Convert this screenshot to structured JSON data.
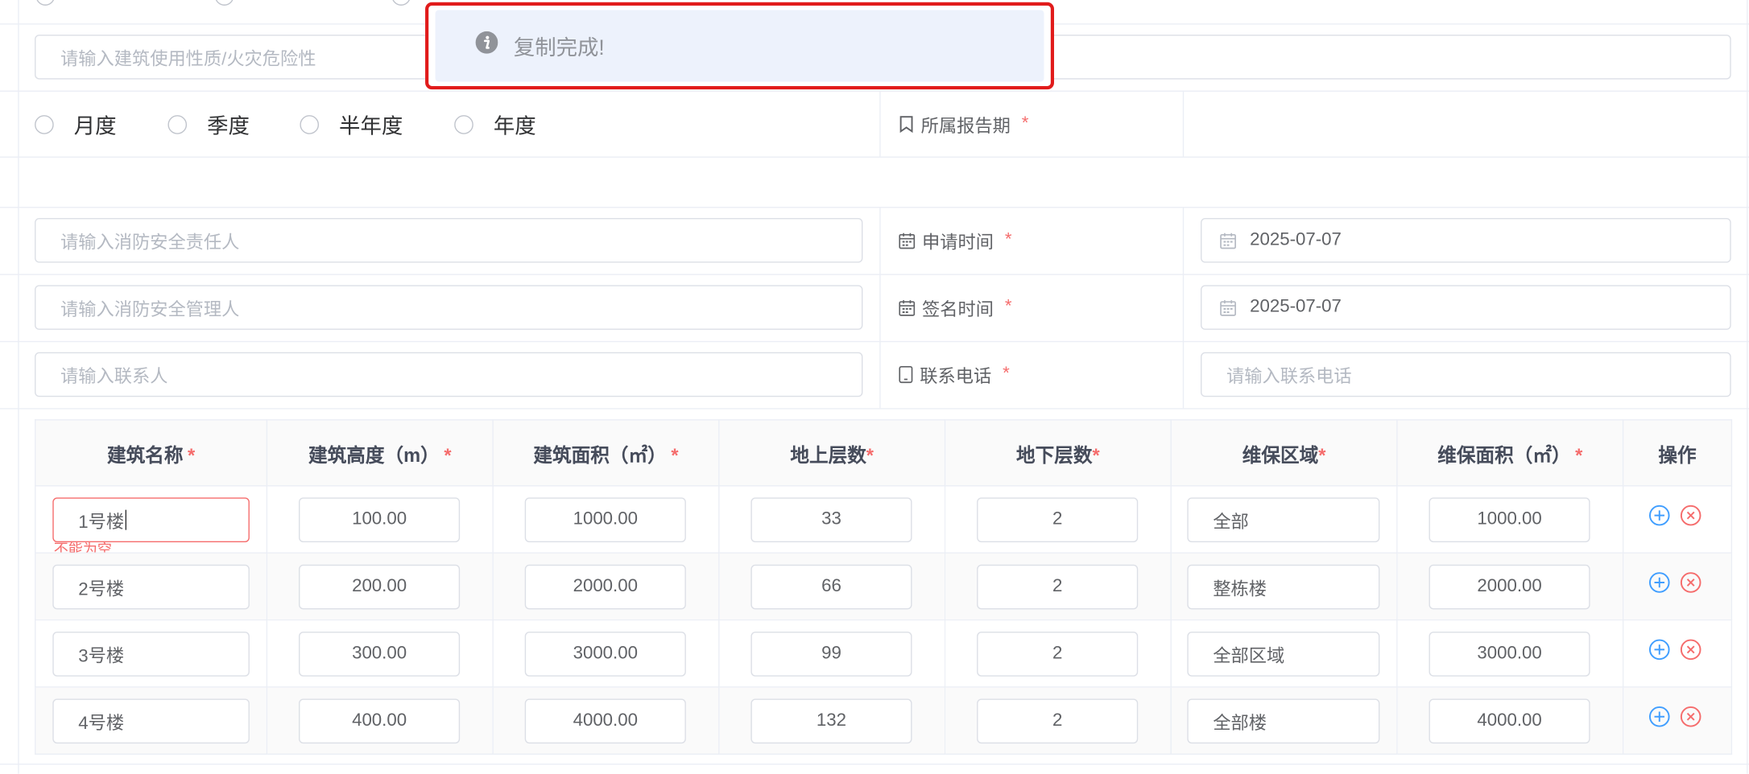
{
  "form": {
    "building_nature_placeholder": "请输入建筑使用性质/火灾危险性",
    "period_options": [
      "月度",
      "季度",
      "半年度",
      "年度"
    ],
    "report_period_label": "所属报告期",
    "safety_responsible_placeholder": "请输入消防安全责任人",
    "apply_time_label": "申请时间",
    "apply_time_value": "2025-07-07",
    "safety_manager_placeholder": "请输入消防安全管理人",
    "sign_time_label": "签名时间",
    "sign_time_value": "2025-07-07",
    "contact_placeholder": "请输入联系人",
    "phone_label": "联系电话",
    "phone_placeholder": "请输入联系电话",
    "required_mark": "*"
  },
  "table": {
    "headers": [
      "建筑名称",
      "建筑高度（m）",
      "建筑面积（㎡）",
      "地上层数",
      "地下层数",
      "维保区域",
      "维保面积（㎡）",
      "操作"
    ],
    "rows": [
      {
        "name": "1号楼",
        "height": "100.00",
        "area": "1000.00",
        "above": "33",
        "below": "2",
        "region": "全部",
        "maint_area": "1000.00"
      },
      {
        "name": "2号楼",
        "height": "200.00",
        "area": "2000.00",
        "above": "66",
        "below": "2",
        "region": "整栋楼",
        "maint_area": "2000.00"
      },
      {
        "name": "3号楼",
        "height": "300.00",
        "area": "3000.00",
        "above": "99",
        "below": "2",
        "region": "全部区域",
        "maint_area": "3000.00"
      },
      {
        "name": "4号楼",
        "height": "400.00",
        "area": "4000.00",
        "above": "132",
        "below": "2",
        "region": "全部楼",
        "maint_area": "4000.00"
      }
    ],
    "error_text": "不能为空"
  },
  "toast": {
    "message": "复制完成!"
  },
  "colors": {
    "required": "#f56c6c",
    "add_icon": "#409eff",
    "delete_icon": "#f56c6c",
    "highlight_border": "#e11b1b"
  }
}
